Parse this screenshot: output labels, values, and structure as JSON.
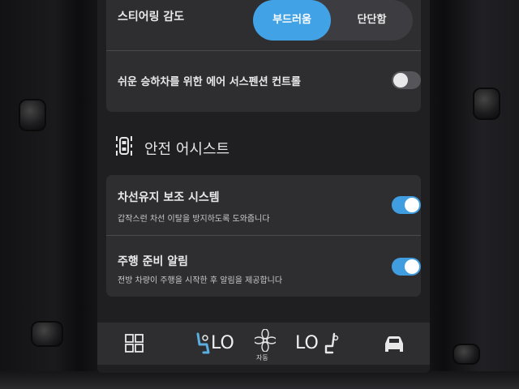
{
  "steering": {
    "label": "스티어링 감도",
    "options": [
      "부드러움",
      "단단함"
    ],
    "selected": "부드러움"
  },
  "air_suspension": {
    "label": "쉬운 승하차를 위한 에어 서스펜션 컨트롤",
    "enabled": false
  },
  "safety_section": {
    "title": "안전 어시스트",
    "icon": "car-lane-icon"
  },
  "lane_keeping": {
    "label": "차선유지 보조 시스템",
    "description": "갑작스런 차선 이탈을 방지하도록 도와줍니다",
    "enabled": true
  },
  "drive_ready": {
    "label": "주행 준비 알림",
    "description": "전방 차량이 주행을 시작한 후 알림을 제공합니다",
    "enabled": true
  },
  "climate_bar": {
    "left_temp": "LO",
    "right_temp": "LO",
    "fan_mode": "자동",
    "icons": [
      "app-grid-icon",
      "seat-heat-left-icon",
      "fan-icon",
      "seat-heat-right-icon",
      "car-icon"
    ]
  },
  "colors": {
    "accent": "#41a3e6",
    "card": "#2e2e31",
    "screen": "#1f1f21"
  }
}
